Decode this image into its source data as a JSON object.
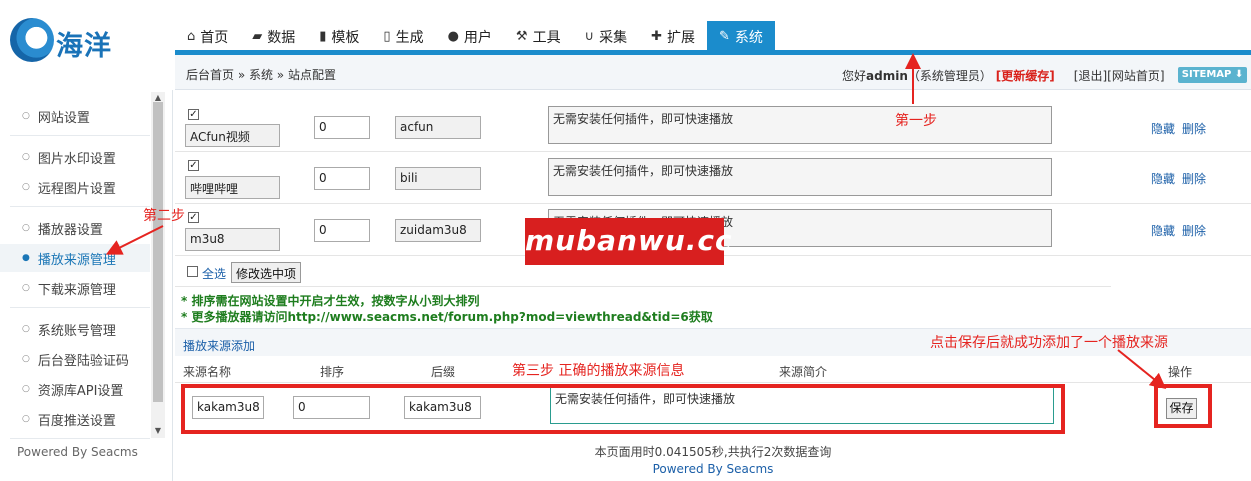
{
  "logo": {
    "brand": "海洋"
  },
  "nav": [
    {
      "label": "首页",
      "icon": "home-icon",
      "glyph": "⌂"
    },
    {
      "label": "数据",
      "icon": "book-icon",
      "glyph": "▰"
    },
    {
      "label": "模板",
      "icon": "file-icon",
      "glyph": "▮"
    },
    {
      "label": "生成",
      "icon": "document-icon",
      "glyph": "▯"
    },
    {
      "label": "用户",
      "icon": "user-icon",
      "glyph": "●"
    },
    {
      "label": "工具",
      "icon": "wrench-icon",
      "glyph": "⚒"
    },
    {
      "label": "采集",
      "icon": "magnet-icon",
      "glyph": "∪"
    },
    {
      "label": "扩展",
      "icon": "puzzle-icon",
      "glyph": "✚"
    },
    {
      "label": "系统",
      "icon": "edit-icon",
      "glyph": "✎",
      "active": true
    }
  ],
  "breadcrumb": "后台首页 » 系统 » 站点配置",
  "user": {
    "greeting": "您好",
    "name": "admin",
    "role": "（系统管理员）",
    "refresh_cache": "[更新缓存]",
    "logout": "[退出]",
    "site_home": "[网站首页]",
    "sitemap": "SITEMAP ⬇"
  },
  "sidebar": {
    "items": [
      {
        "label": "网站设置"
      },
      {
        "label": "图片水印设置"
      },
      {
        "label": "远程图片设置"
      },
      {
        "label": "播放器设置"
      },
      {
        "label": "播放来源管理",
        "active": true
      },
      {
        "label": "下载来源管理"
      },
      {
        "label": "系统账号管理"
      },
      {
        "label": "后台登陆验证码"
      },
      {
        "label": "资源库API设置"
      },
      {
        "label": "百度推送设置"
      }
    ],
    "powered": "Powered By Seacms"
  },
  "rows": [
    {
      "checked": true,
      "name": "ACfun视频",
      "sort": "0",
      "suffix": "acfun",
      "desc": "无需安装任何插件，即可快速播放",
      "hide": "隐藏",
      "delete": "删除"
    },
    {
      "checked": true,
      "name": "哔哩哔哩",
      "sort": "0",
      "suffix": "bili",
      "desc": "无需安装任何插件，即可快速播放",
      "hide": "隐藏",
      "delete": "删除"
    },
    {
      "checked": true,
      "name": "m3u8",
      "sort": "0",
      "suffix": "zuidam3u8",
      "desc": "无需安装任何插件，即可快速播放",
      "hide": "隐藏",
      "delete": "删除"
    }
  ],
  "actions": {
    "select_all": "全选",
    "modify_selected": "修改选中项"
  },
  "notes": [
    "* 排序需在网站设置中开启才生效，按数字从小到大排列",
    "* 更多播放器请访问http://www.seacms.net/forum.php?mod=viewthread&tid=6获取"
  ],
  "add_section": {
    "title": "播放来源添加",
    "columns": [
      "来源名称",
      "排序",
      "后缀",
      "来源简介",
      "操作"
    ],
    "name": "kakam3u8",
    "sort": "0",
    "suffix": "kakam3u8",
    "desc": "无需安装任何插件，即可快速播放",
    "save": "保存"
  },
  "footer": {
    "stats": "本页面用时0.041505秒,共执行2次数据查询",
    "powered": "Powered By Seacms"
  },
  "annotations": {
    "step1": "第一步",
    "step2": "第二步",
    "step3": "第三步  正确的播放来源信息",
    "save_note": "点击保存后就成功添加了一个播放来源",
    "watermark": "mubanwu.cc"
  },
  "colors": {
    "accent": "#1b8ccc",
    "annotation": "#e52420",
    "note_green": "#1e7d1e"
  }
}
